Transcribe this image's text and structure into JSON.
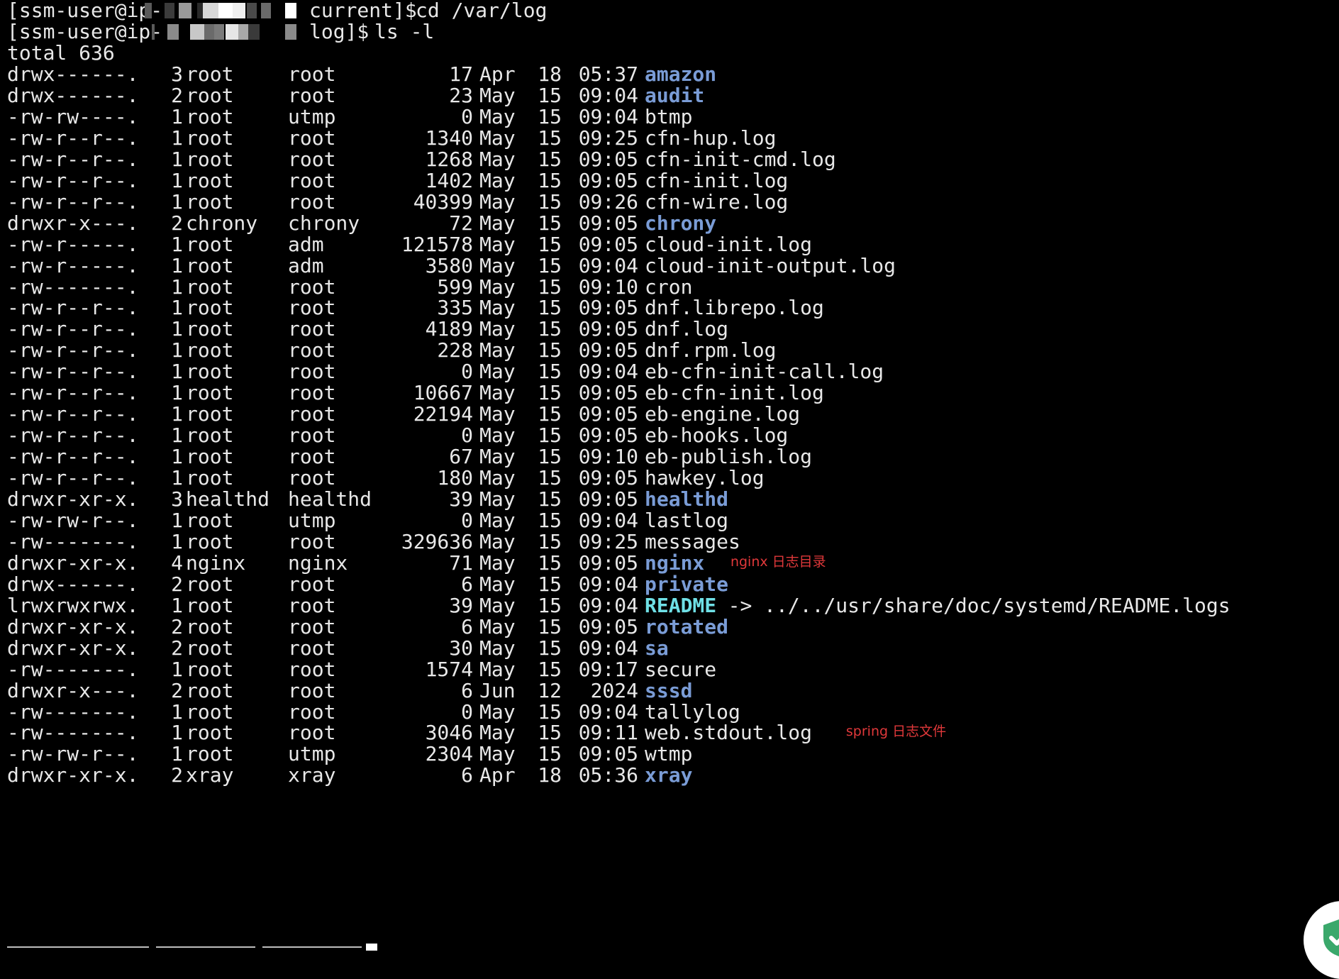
{
  "prompts": [
    {
      "user": "[ssm-user@ip-",
      "dir": "current]$",
      "command": "cd /var/log"
    },
    {
      "user": "[ssm-user@ip-",
      "dir": "log]$",
      "command": "ls -l"
    }
  ],
  "total_line": "total 636",
  "entries": [
    {
      "perm": "drwx------.",
      "links": "3",
      "owner": "root",
      "group": "root",
      "size": "17",
      "month": "Apr",
      "day": "18",
      "time": "05:37",
      "name": "amazon",
      "type": "dir"
    },
    {
      "perm": "drwx------.",
      "links": "2",
      "owner": "root",
      "group": "root",
      "size": "23",
      "month": "May",
      "day": "15",
      "time": "09:04",
      "name": "audit",
      "type": "dir"
    },
    {
      "perm": "-rw-rw----.",
      "links": "1",
      "owner": "root",
      "group": "utmp",
      "size": "0",
      "month": "May",
      "day": "15",
      "time": "09:04",
      "name": "btmp",
      "type": "file"
    },
    {
      "perm": "-rw-r--r--.",
      "links": "1",
      "owner": "root",
      "group": "root",
      "size": "1340",
      "month": "May",
      "day": "15",
      "time": "09:25",
      "name": "cfn-hup.log",
      "type": "file"
    },
    {
      "perm": "-rw-r--r--.",
      "links": "1",
      "owner": "root",
      "group": "root",
      "size": "1268",
      "month": "May",
      "day": "15",
      "time": "09:05",
      "name": "cfn-init-cmd.log",
      "type": "file"
    },
    {
      "perm": "-rw-r--r--.",
      "links": "1",
      "owner": "root",
      "group": "root",
      "size": "1402",
      "month": "May",
      "day": "15",
      "time": "09:05",
      "name": "cfn-init.log",
      "type": "file"
    },
    {
      "perm": "-rw-r--r--.",
      "links": "1",
      "owner": "root",
      "group": "root",
      "size": "40399",
      "month": "May",
      "day": "15",
      "time": "09:26",
      "name": "cfn-wire.log",
      "type": "file"
    },
    {
      "perm": "drwxr-x---.",
      "links": "2",
      "owner": "chrony",
      "group": "chrony",
      "size": "72",
      "month": "May",
      "day": "15",
      "time": "09:05",
      "name": "chrony",
      "type": "dir"
    },
    {
      "perm": "-rw-r-----.",
      "links": "1",
      "owner": "root",
      "group": "adm",
      "size": "121578",
      "month": "May",
      "day": "15",
      "time": "09:05",
      "name": "cloud-init.log",
      "type": "file"
    },
    {
      "perm": "-rw-r-----.",
      "links": "1",
      "owner": "root",
      "group": "adm",
      "size": "3580",
      "month": "May",
      "day": "15",
      "time": "09:04",
      "name": "cloud-init-output.log",
      "type": "file"
    },
    {
      "perm": "-rw-------.",
      "links": "1",
      "owner": "root",
      "group": "root",
      "size": "599",
      "month": "May",
      "day": "15",
      "time": "09:10",
      "name": "cron",
      "type": "file"
    },
    {
      "perm": "-rw-r--r--.",
      "links": "1",
      "owner": "root",
      "group": "root",
      "size": "335",
      "month": "May",
      "day": "15",
      "time": "09:05",
      "name": "dnf.librepo.log",
      "type": "file"
    },
    {
      "perm": "-rw-r--r--.",
      "links": "1",
      "owner": "root",
      "group": "root",
      "size": "4189",
      "month": "May",
      "day": "15",
      "time": "09:05",
      "name": "dnf.log",
      "type": "file"
    },
    {
      "perm": "-rw-r--r--.",
      "links": "1",
      "owner": "root",
      "group": "root",
      "size": "228",
      "month": "May",
      "day": "15",
      "time": "09:05",
      "name": "dnf.rpm.log",
      "type": "file"
    },
    {
      "perm": "-rw-r--r--.",
      "links": "1",
      "owner": "root",
      "group": "root",
      "size": "0",
      "month": "May",
      "day": "15",
      "time": "09:04",
      "name": "eb-cfn-init-call.log",
      "type": "file"
    },
    {
      "perm": "-rw-r--r--.",
      "links": "1",
      "owner": "root",
      "group": "root",
      "size": "10667",
      "month": "May",
      "day": "15",
      "time": "09:05",
      "name": "eb-cfn-init.log",
      "type": "file"
    },
    {
      "perm": "-rw-r--r--.",
      "links": "1",
      "owner": "root",
      "group": "root",
      "size": "22194",
      "month": "May",
      "day": "15",
      "time": "09:05",
      "name": "eb-engine.log",
      "type": "file"
    },
    {
      "perm": "-rw-r--r--.",
      "links": "1",
      "owner": "root",
      "group": "root",
      "size": "0",
      "month": "May",
      "day": "15",
      "time": "09:05",
      "name": "eb-hooks.log",
      "type": "file"
    },
    {
      "perm": "-rw-r--r--.",
      "links": "1",
      "owner": "root",
      "group": "root",
      "size": "67",
      "month": "May",
      "day": "15",
      "time": "09:10",
      "name": "eb-publish.log",
      "type": "file"
    },
    {
      "perm": "-rw-r--r--.",
      "links": "1",
      "owner": "root",
      "group": "root",
      "size": "180",
      "month": "May",
      "day": "15",
      "time": "09:05",
      "name": "hawkey.log",
      "type": "file"
    },
    {
      "perm": "drwxr-xr-x.",
      "links": "3",
      "owner": "healthd",
      "group": "healthd",
      "size": "39",
      "month": "May",
      "day": "15",
      "time": "09:05",
      "name": "healthd",
      "type": "dir"
    },
    {
      "perm": "-rw-rw-r--.",
      "links": "1",
      "owner": "root",
      "group": "utmp",
      "size": "0",
      "month": "May",
      "day": "15",
      "time": "09:04",
      "name": "lastlog",
      "type": "file"
    },
    {
      "perm": "-rw-------.",
      "links": "1",
      "owner": "root",
      "group": "root",
      "size": "329636",
      "month": "May",
      "day": "15",
      "time": "09:25",
      "name": "messages",
      "type": "file"
    },
    {
      "perm": "drwxr-xr-x.",
      "links": "4",
      "owner": "nginx",
      "group": "nginx",
      "size": "71",
      "month": "May",
      "day": "15",
      "time": "09:05",
      "name": "nginx",
      "type": "dir",
      "annotation": "nginx 日志目录"
    },
    {
      "perm": "drwx------.",
      "links": "2",
      "owner": "root",
      "group": "root",
      "size": "6",
      "month": "May",
      "day": "15",
      "time": "09:04",
      "name": "private",
      "type": "dir"
    },
    {
      "perm": "lrwxrwxrwx.",
      "links": "1",
      "owner": "root",
      "group": "root",
      "size": "39",
      "month": "May",
      "day": "15",
      "time": "09:04",
      "name": "README",
      "type": "link",
      "target": "-> ../../usr/share/doc/systemd/README.logs"
    },
    {
      "perm": "drwxr-xr-x.",
      "links": "2",
      "owner": "root",
      "group": "root",
      "size": "6",
      "month": "May",
      "day": "15",
      "time": "09:05",
      "name": "rotated",
      "type": "dir"
    },
    {
      "perm": "drwxr-xr-x.",
      "links": "2",
      "owner": "root",
      "group": "root",
      "size": "30",
      "month": "May",
      "day": "15",
      "time": "09:04",
      "name": "sa",
      "type": "dir"
    },
    {
      "perm": "-rw-------.",
      "links": "1",
      "owner": "root",
      "group": "root",
      "size": "1574",
      "month": "May",
      "day": "15",
      "time": "09:17",
      "name": "secure",
      "type": "file"
    },
    {
      "perm": "drwxr-x---.",
      "links": "2",
      "owner": "root",
      "group": "root",
      "size": "6",
      "month": "Jun",
      "day": "12",
      "time": "2024",
      "name": "sssd",
      "type": "dir"
    },
    {
      "perm": "-rw-------.",
      "links": "1",
      "owner": "root",
      "group": "root",
      "size": "0",
      "month": "May",
      "day": "15",
      "time": "09:04",
      "name": "tallylog",
      "type": "file"
    },
    {
      "perm": "-rw-------.",
      "links": "1",
      "owner": "root",
      "group": "root",
      "size": "3046",
      "month": "May",
      "day": "15",
      "time": "09:11",
      "name": "web.stdout.log",
      "type": "file",
      "annotation": "spring 日志文件"
    },
    {
      "perm": "-rw-rw-r--.",
      "links": "1",
      "owner": "root",
      "group": "utmp",
      "size": "2304",
      "month": "May",
      "day": "15",
      "time": "09:05",
      "name": "wtmp",
      "type": "file"
    },
    {
      "perm": "drwxr-xr-x.",
      "links": "2",
      "owner": "xray",
      "group": "xray",
      "size": "6",
      "month": "Apr",
      "day": "18",
      "time": "05:36",
      "name": "xray",
      "type": "dir"
    }
  ],
  "colors": {
    "background": "#000000",
    "text": "#e8e8e8",
    "directory": "#7a9cd6",
    "symlink": "#6fe0e6",
    "annotation": "#e0383a",
    "badge_icon": "#3aa86b"
  },
  "icons": {
    "corner_badge": "shield-check-icon"
  }
}
